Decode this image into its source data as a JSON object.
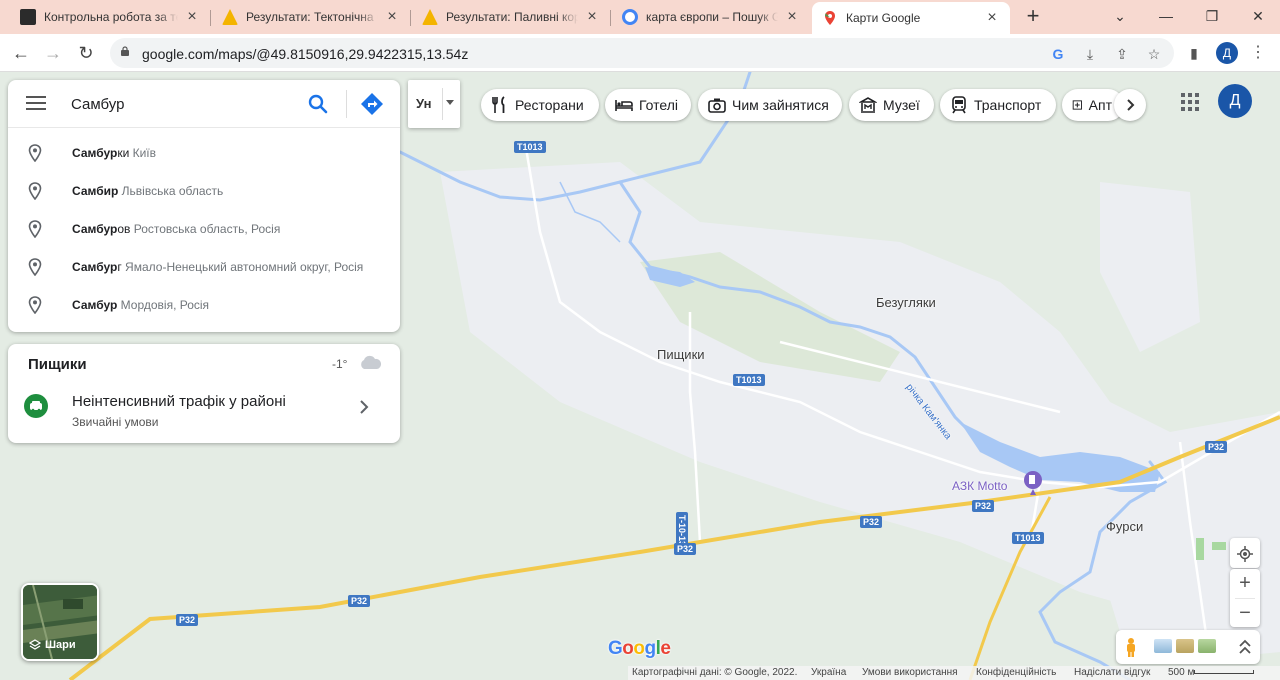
{
  "browser": {
    "tabs": [
      {
        "title": "Контрольна робота за тему",
        "active": false
      },
      {
        "title": "Результати: Тектонічна будова",
        "active": false
      },
      {
        "title": "Результати: Паливні корисні",
        "active": false
      },
      {
        "title": "карта європи – Пошук Google",
        "active": false
      },
      {
        "title": "Карти Google",
        "active": true
      }
    ],
    "new_tab": "+",
    "window_controls": [
      "⌄",
      "—",
      "❐",
      "✕"
    ],
    "url": "google.com/maps/@49.8150916,29.9422315,13.54z",
    "profile_letter": "Д"
  },
  "search": {
    "query": "Самбур",
    "suggestions": [
      {
        "match": "Самбур",
        "rest": "ки",
        "sub": "Київ"
      },
      {
        "match": "Самбир",
        "rest": "",
        "sub": "Львівська область"
      },
      {
        "match": "Самбур",
        "rest": "ов",
        "sub": "Ростовська область, Росія"
      },
      {
        "match": "Самбур",
        "rest": "г",
        "sub": "Ямало-Ненецький автономний округ, Росія"
      },
      {
        "match": "Самбур",
        "rest": "",
        "sub": "Мордовія, Росія"
      }
    ]
  },
  "traffic_card": {
    "place": "Пищики",
    "temperature": "-1°",
    "headline": "Неінтенсивний трафік у районі",
    "subline": "Звичайні умови"
  },
  "language_button": "Ун",
  "chips": [
    {
      "label": "Ресторани",
      "icon": "fork-knife-icon"
    },
    {
      "label": "Готелі",
      "icon": "bed-icon"
    },
    {
      "label": "Чим зайнятися",
      "icon": "camera-icon"
    },
    {
      "label": "Музеї",
      "icon": "museum-icon"
    },
    {
      "label": "Транспорт",
      "icon": "train-icon"
    },
    {
      "label": "Апт",
      "icon": "pharmacy-icon"
    }
  ],
  "account_letter": "Д",
  "map": {
    "places": [
      "Безугляки",
      "Пищики",
      "Фурси"
    ],
    "river": "річка Кам'янка",
    "poi": "АЗК Motto",
    "road_signs": [
      "T1013",
      "T1013",
      "T1013",
      "T-10-13",
      "P32",
      "P32",
      "P32",
      "P32",
      "P32",
      "P32"
    ],
    "layers_label": "Шари",
    "google_logo": "Google"
  },
  "footer": {
    "map_data": "Картографічні дані: © Google, 2022.",
    "country": "Україна",
    "terms": "Умови використання",
    "privacy": "Конфіденційність",
    "feedback": "Надіслати відгук",
    "scale": "500 м"
  },
  "colors": {
    "tab_bar": "#f7d9d0",
    "map_bg": "#e4ece4",
    "water": "#a8c8f5",
    "settlement": "#eceef2",
    "highway": "#f2c94c",
    "road_sign": "#3f77c2",
    "accent_blue": "#1a73e8",
    "traffic_green": "#1e8e3e"
  }
}
